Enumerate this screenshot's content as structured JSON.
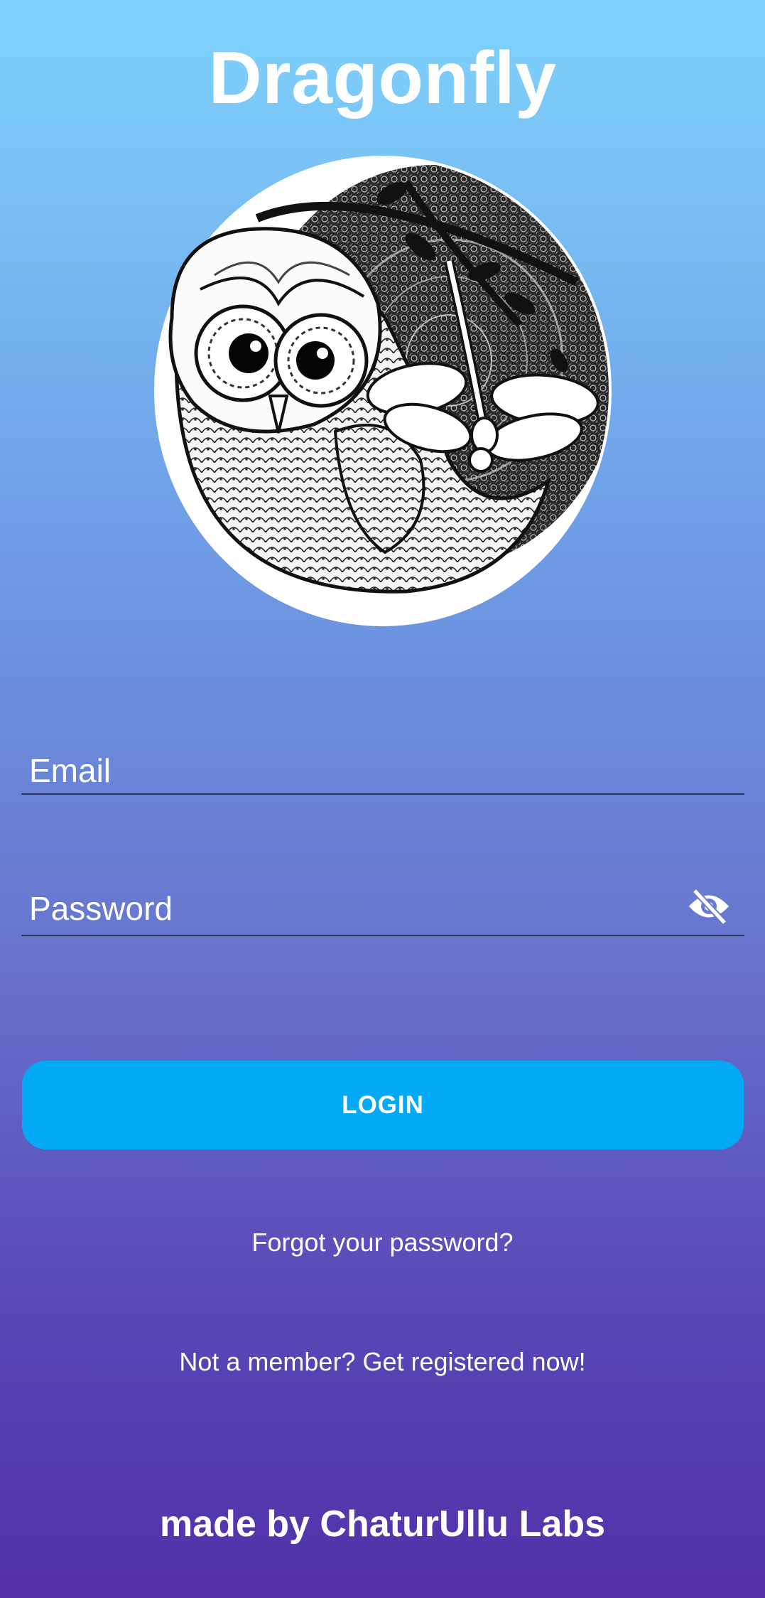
{
  "app": {
    "title": "Dragonfly"
  },
  "logo": {
    "icon": "owl-dragonfly-mandala-logo"
  },
  "login_form": {
    "email": {
      "placeholder": "Email",
      "value": ""
    },
    "password": {
      "placeholder": "Password",
      "value": "",
      "toggle_icon": "eye-off-icon"
    },
    "login_button_label": "LOGIN"
  },
  "links": {
    "forgot_password": "Forgot your password?",
    "register": "Not a member? Get registered now!"
  },
  "footer": {
    "credit": "made by ChaturUllu Labs"
  },
  "colors": {
    "gradient_top": "#7fd3fd",
    "gradient_bottom": "#5131a8",
    "button": "#03a9f4",
    "text": "#ffffff"
  }
}
